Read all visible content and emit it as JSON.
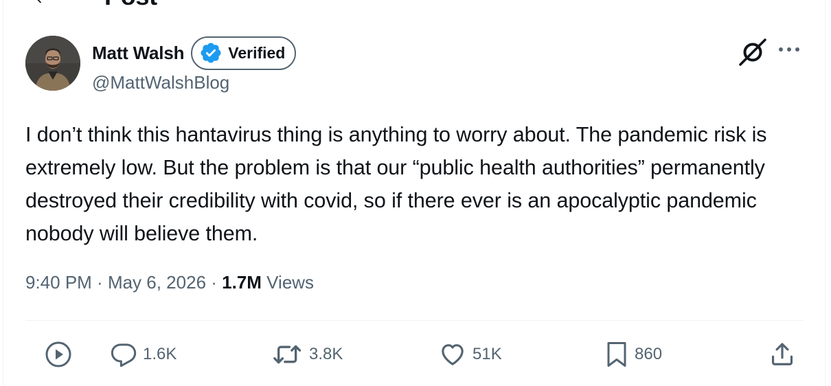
{
  "header": {
    "title": "Post"
  },
  "author": {
    "display_name": "Matt Walsh",
    "verified_label": "Verified",
    "handle": "@MattWalshBlog"
  },
  "tweet": {
    "text": "I don’t think this hantavirus thing is anything to worry about. The pandemic risk is extremely low. But the problem is that our “public health authorities” permanently destroyed their credibility with covid, so if there ever is an apocalyptic pandemic nobody will believe them."
  },
  "meta": {
    "time": "9:40 PM",
    "separator": " · ",
    "date": "May 6, 2026",
    "views_count": "1.7M",
    "views_label": " Views"
  },
  "actions": {
    "replies": "1.6K",
    "reposts": "3.8K",
    "likes": "51K",
    "bookmarks": "860"
  },
  "icons": {
    "back": "arrow-left-icon",
    "grok": "grok-icon",
    "more": "more-icon",
    "play": "play-icon",
    "reply": "reply-icon",
    "repost": "repost-icon",
    "like": "heart-icon",
    "bookmark": "bookmark-icon",
    "share": "share-icon",
    "verified": "verified-badge-icon"
  },
  "colors": {
    "verified_blue": "#1d9bf0",
    "secondary_text": "#536471",
    "primary_text": "#0f1419"
  }
}
